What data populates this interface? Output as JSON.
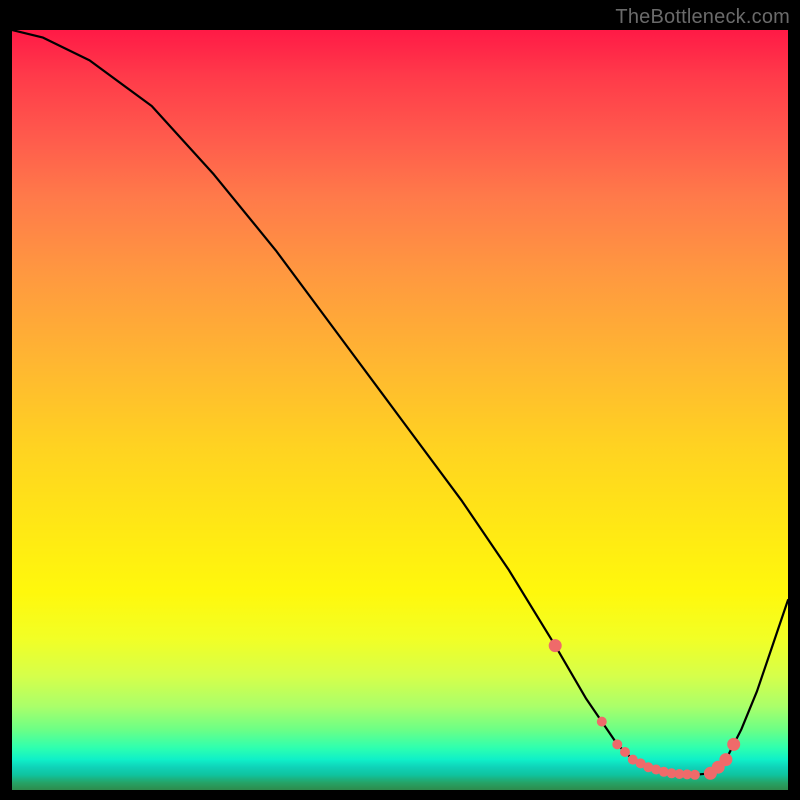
{
  "watermark": "TheBottleneck.com",
  "colors": {
    "curve_stroke": "#000000",
    "marker_fill": "#ef6a6a",
    "marker_stroke": "#ef6a6a",
    "background": "#000000"
  },
  "chart_data": {
    "type": "line",
    "title": "",
    "xlabel": "",
    "ylabel": "",
    "xlim": [
      0,
      100
    ],
    "ylim": [
      0,
      100
    ],
    "grid": false,
    "legend": false,
    "series": [
      {
        "name": "curve",
        "x": [
          0,
          4,
          10,
          18,
          26,
          34,
          42,
          50,
          58,
          64,
          70,
          74,
          76,
          78,
          80,
          82,
          84,
          86,
          88,
          90,
          92,
          94,
          96,
          98,
          100
        ],
        "y": [
          100,
          99,
          96,
          90,
          81,
          71,
          60,
          49,
          38,
          29,
          19,
          12,
          9,
          6,
          4,
          3,
          2.4,
          2.1,
          2.0,
          2.2,
          4,
          8,
          13,
          19,
          25
        ]
      }
    ],
    "markers": {
      "name": "salient-points",
      "x": [
        70,
        76,
        78,
        79,
        80,
        81,
        82,
        83,
        84,
        85,
        86,
        87,
        88,
        90,
        91,
        92,
        93
      ],
      "y": [
        19,
        9,
        6,
        5,
        4,
        3.5,
        3,
        2.7,
        2.4,
        2.2,
        2.1,
        2.05,
        2.0,
        2.2,
        3,
        4,
        6
      ]
    }
  }
}
